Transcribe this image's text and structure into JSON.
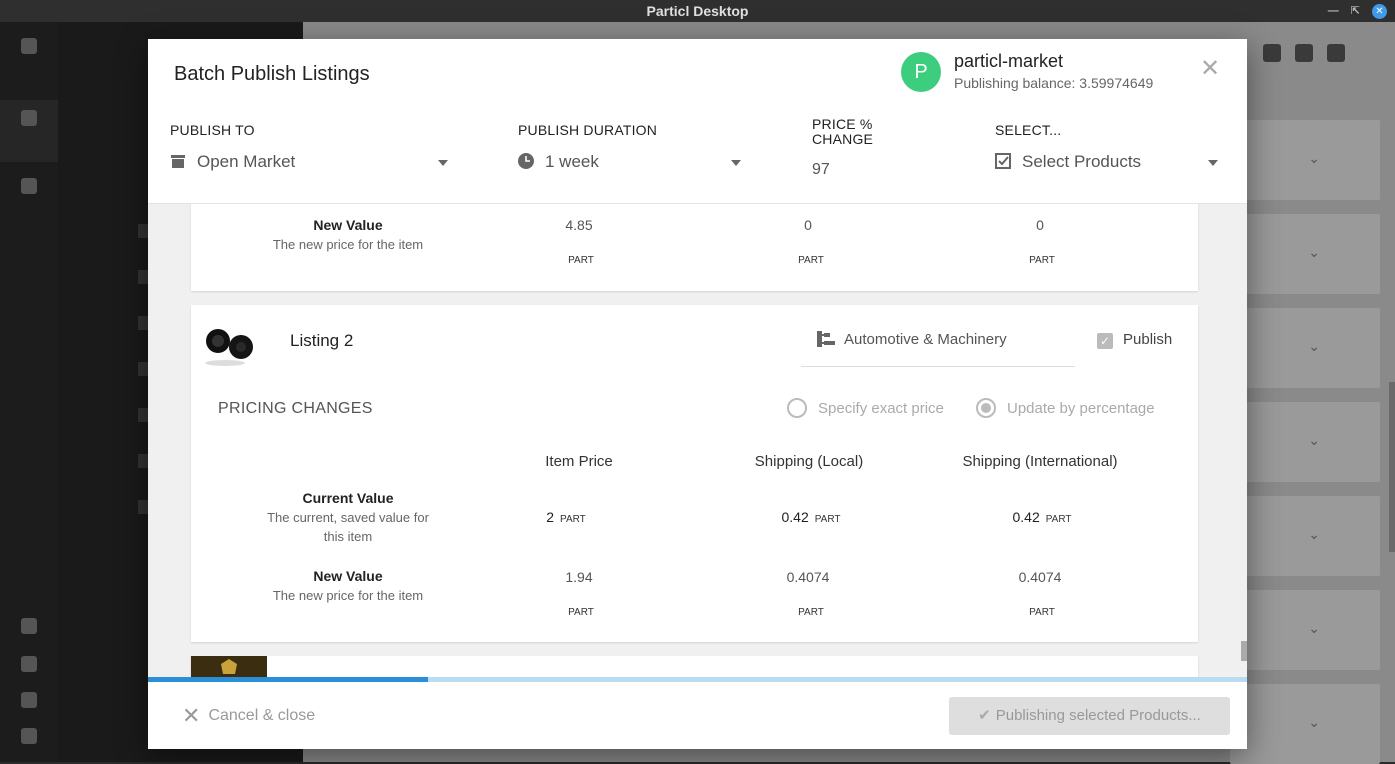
{
  "window": {
    "title": "Particl Desktop"
  },
  "modal": {
    "title": "Batch Publish Listings",
    "account": {
      "avatar_letter": "P",
      "name": "particl-market",
      "balance": "Publishing balance: 3.59974649"
    },
    "fields": {
      "publish_to": {
        "label": "PUBLISH TO",
        "value": "Open Market"
      },
      "duration": {
        "label": "PUBLISH DURATION",
        "value": "1 week"
      },
      "price_change": {
        "label_line1": "PRICE %",
        "label_line2": "CHANGE",
        "value": "97"
      },
      "select": {
        "label": "SELECT...",
        "value": "Select Products"
      }
    },
    "prev_listing": {
      "new_value_title": "New Value",
      "new_value_sub": "The new price for the item",
      "new_values": [
        "4.85",
        "0",
        "0"
      ],
      "unit": "PART"
    },
    "listing2": {
      "name": "Listing 2",
      "category": "Automotive & Machinery",
      "publish_label": "Publish",
      "pricing_heading": "PRICING CHANGES",
      "radio_exact": "Specify exact price",
      "radio_percent": "Update by percentage",
      "columns": [
        "Item Price",
        "Shipping (Local)",
        "Shipping (International)"
      ],
      "current_title": "Current Value",
      "current_sub": "The current, saved value for this item",
      "current_values": [
        "2",
        "0.42",
        "0.42"
      ],
      "new_title": "New Value",
      "new_sub": "The new price for the item",
      "new_values": [
        "1.94",
        "0.4074",
        "0.4074"
      ],
      "unit": "PART"
    },
    "progress": 0.255,
    "footer": {
      "cancel": "Cancel & close",
      "publish": "Publishing selected Products..."
    }
  },
  "colors": {
    "accent": "#2a8fd6",
    "avatar": "#3ccd7f",
    "progress_track": "#b9dcf2"
  }
}
